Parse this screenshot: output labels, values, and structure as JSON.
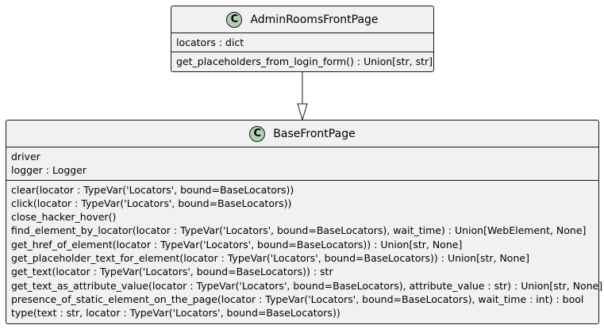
{
  "classes": {
    "admin_rooms": {
      "stereotype_letter": "C",
      "name": "AdminRoomsFrontPage",
      "fields": [
        "locators : dict"
      ],
      "methods": [
        "get_placeholders_from_login_form() : Union[str, str]"
      ]
    },
    "base": {
      "stereotype_letter": "C",
      "name": "BaseFrontPage",
      "fields": [
        "driver",
        "logger : Logger"
      ],
      "methods": [
        "clear(locator : TypeVar('Locators', bound=BaseLocators))",
        "click(locator : TypeVar('Locators', bound=BaseLocators))",
        "close_hacker_hover()",
        "find_element_by_locator(locator : TypeVar('Locators', bound=BaseLocators), wait_time) : Union[WebElement, None]",
        "get_href_of_element(locator : TypeVar('Locators', bound=BaseLocators)) : Union[str, None]",
        "get_placeholder_text_for_element(locator : TypeVar('Locators', bound=BaseLocators)) : Union[str, None]",
        "get_text(locator : TypeVar('Locators', bound=BaseLocators)) : str",
        "get_text_as_attribute_value(locator : TypeVar('Locators', bound=BaseLocators), attribute_value : str) : Union[str, None]",
        "presence_of_static_element_on_the_page(locator : TypeVar('Locators', bound=BaseLocators), wait_time : int) : bool",
        "type(text : str, locator : TypeVar('Locators', bound=BaseLocators))"
      ]
    }
  },
  "colors": {
    "class_fill": "#f1f1f1",
    "border": "#181818",
    "badge_fill": "#add1b2"
  }
}
